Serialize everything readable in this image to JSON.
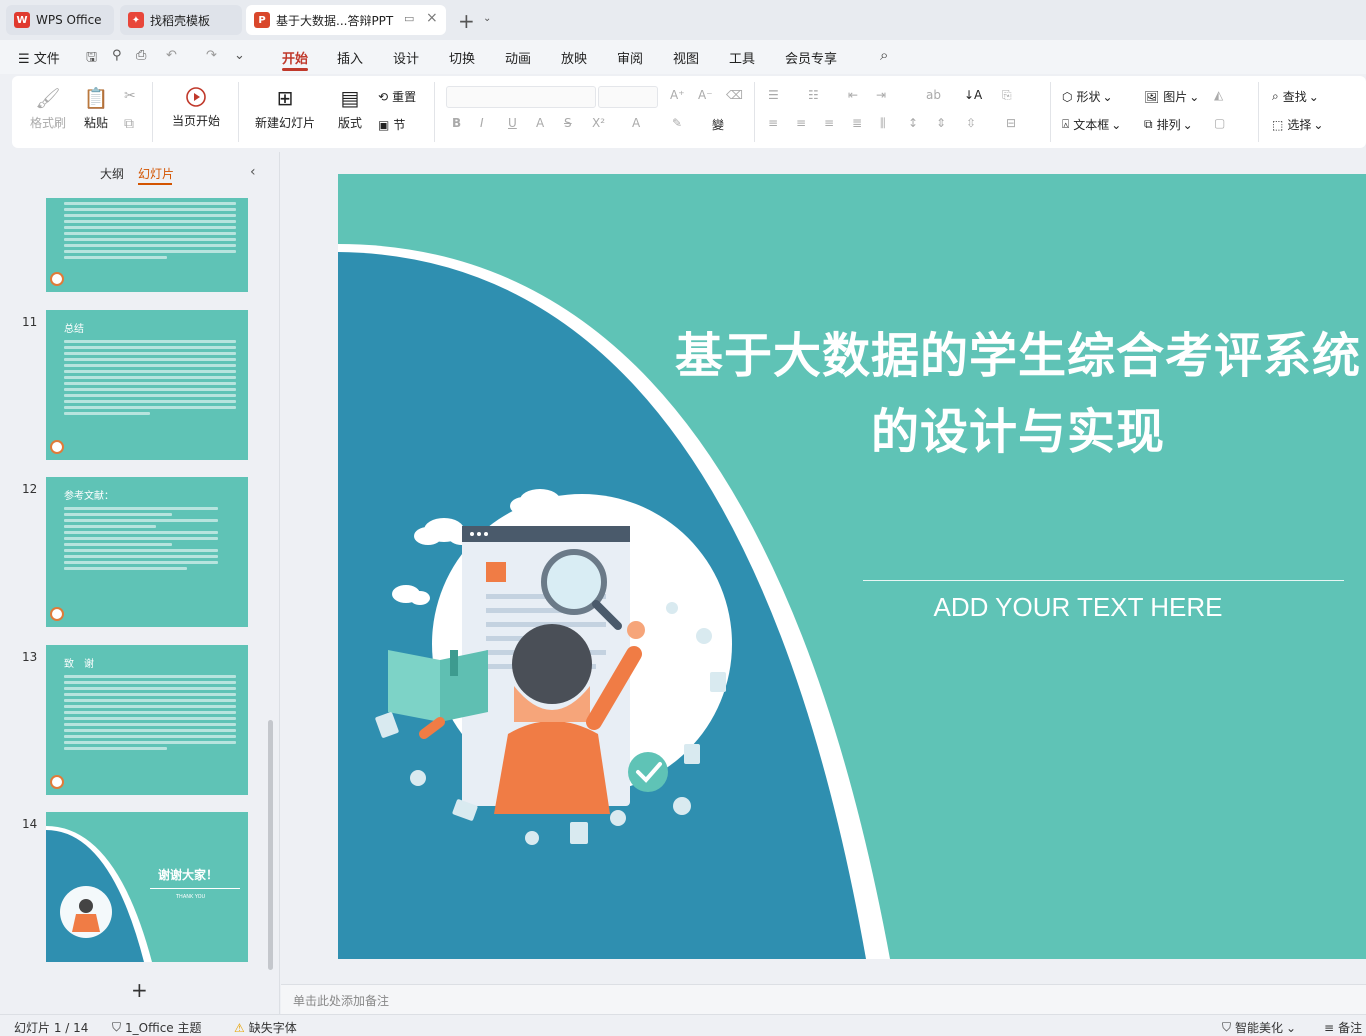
{
  "titlebar": {
    "tabs": [
      {
        "label": "WPS Office"
      },
      {
        "label": "找稻壳模板"
      },
      {
        "label": "基于大数据...答辩PPT"
      }
    ]
  },
  "menu": {
    "file": "文件",
    "items": [
      "开始",
      "插入",
      "设计",
      "切换",
      "动画",
      "放映",
      "审阅",
      "视图",
      "工具",
      "会员专享"
    ]
  },
  "ribbon": {
    "format_painter": "格式刷",
    "paste": "粘贴",
    "play_from_current": "当页开始",
    "new_slide": "新建幻灯片",
    "layout": "版式",
    "reset": "重置",
    "section": "节",
    "shape": "形状",
    "picture": "图片",
    "find": "查找",
    "textbox": "文本框",
    "arrange": "排列",
    "select": "选择"
  },
  "leftpanel": {
    "tab_outline": "大纲",
    "tab_slides": "幻灯片",
    "slides": [
      {
        "num": "11",
        "title": "总结"
      },
      {
        "num": "12",
        "title": "参考文献："
      },
      {
        "num": "13",
        "title": "致　谢"
      },
      {
        "num": "14",
        "title": "谢谢大家！",
        "subtitle": "THANK YOU"
      }
    ],
    "add_label": "+"
  },
  "slide": {
    "title_line1": "基于大数据的学生综合考评系统",
    "title_line2": "的设计与实现",
    "subtitle": "ADD YOUR TEXT HERE"
  },
  "notes": {
    "placeholder": "单击此处添加备注"
  },
  "status": {
    "slide_count": "幻灯片 1 / 14",
    "theme": "1_Office 主题",
    "missing_font": "缺失字体",
    "beautify": "智能美化",
    "notes_btn": "备注"
  },
  "colors": {
    "accent_red": "#c0392b",
    "slide_teal": "#5fc3b6",
    "slide_blue": "#2f8fb0"
  }
}
